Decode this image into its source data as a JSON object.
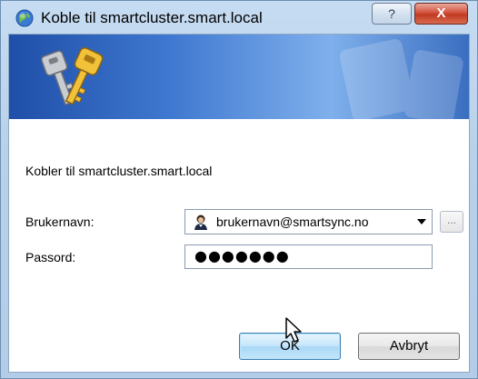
{
  "window": {
    "title": "Koble til smartcluster.smart.local",
    "help_symbol": "?",
    "close_symbol": "X"
  },
  "banner": {
    "icon": "keys-icon"
  },
  "form": {
    "status_text": "Kobler til smartcluster.smart.local",
    "username_label": "Brukernavn:",
    "username_value": "brukernavn@smartsync.no",
    "username_icon": "user-avatar-icon",
    "browse_label": "...",
    "password_label": "Passord:",
    "password_value": "●●●●●●●"
  },
  "buttons": {
    "ok_label": "OK",
    "cancel_label": "Avbryt"
  },
  "colors": {
    "title_bar": "#c6dcf2",
    "banner_dark": "#1f4fa8",
    "banner_light": "#7fb0ec",
    "close_button": "#c13a22",
    "ok_button_border": "#3c7fb1"
  }
}
